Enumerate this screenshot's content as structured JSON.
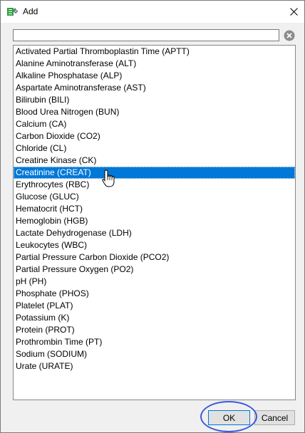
{
  "window": {
    "title": "Add",
    "icon": "add-list-icon"
  },
  "search": {
    "value": "",
    "placeholder": ""
  },
  "list": {
    "selected_index": 10,
    "items": [
      "Activated Partial Thromboplastin Time (APTT)",
      "Alanine Aminotransferase (ALT)",
      "Alkaline Phosphatase (ALP)",
      "Aspartate Aminotransferase (AST)",
      "Bilirubin (BILI)",
      "Blood Urea Nitrogen (BUN)",
      "Calcium (CA)",
      "Carbon Dioxide (CO2)",
      "Chloride (CL)",
      "Creatine Kinase (CK)",
      "Creatinine (CREAT)",
      "Erythrocytes (RBC)",
      "Glucose (GLUC)",
      "Hematocrit (HCT)",
      "Hemoglobin (HGB)",
      "Lactate Dehydrogenase (LDH)",
      "Leukocytes (WBC)",
      "Partial Pressure Carbon Dioxide (PCO2)",
      "Partial Pressure Oxygen (PO2)",
      "pH (PH)",
      "Phosphate (PHOS)",
      "Platelet (PLAT)",
      "Potassium (K)",
      "Protein (PROT)",
      "Prothrombin Time (PT)",
      "Sodium (SODIUM)",
      "Urate (URATE)"
    ]
  },
  "buttons": {
    "ok": "OK",
    "cancel": "Cancel"
  },
  "colors": {
    "selection": "#0078d7",
    "annotation": "#3b5bdb",
    "icon_green": "#2e9e3e"
  }
}
